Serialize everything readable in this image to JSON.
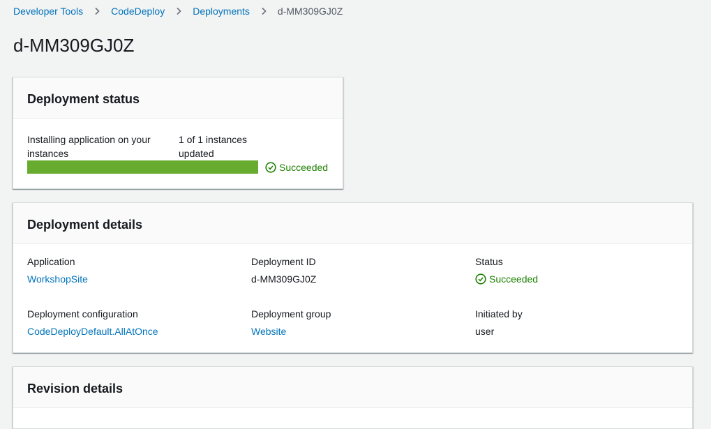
{
  "breadcrumb": {
    "items": [
      {
        "label": "Developer Tools"
      },
      {
        "label": "CodeDeploy"
      },
      {
        "label": "Deployments"
      }
    ],
    "current": "d-MM309GJ0Z"
  },
  "page": {
    "title": "d-MM309GJ0Z"
  },
  "deployment_status": {
    "title": "Deployment status",
    "step_label": "Installing application on your instances",
    "instances_text": "1 of 1 instances updated",
    "progress": 1.0,
    "result_label": "Succeeded",
    "progress_color": "#67ab2f",
    "success_color": "#1d8102"
  },
  "deployment_details": {
    "title": "Deployment details",
    "application": {
      "label": "Application",
      "value": "WorkshopSite"
    },
    "deployment_id": {
      "label": "Deployment ID",
      "value": "d-MM309GJ0Z"
    },
    "status": {
      "label": "Status",
      "value": "Succeeded"
    },
    "deployment_configuration": {
      "label": "Deployment configuration",
      "value": "CodeDeployDefault.AllAtOnce"
    },
    "deployment_group": {
      "label": "Deployment group",
      "value": "Website"
    },
    "initiated_by": {
      "label": "Initiated by",
      "value": "user"
    }
  },
  "revision_details": {
    "title": "Revision details"
  },
  "colors": {
    "link": "#0073bb",
    "background": "#f2f3f3"
  }
}
